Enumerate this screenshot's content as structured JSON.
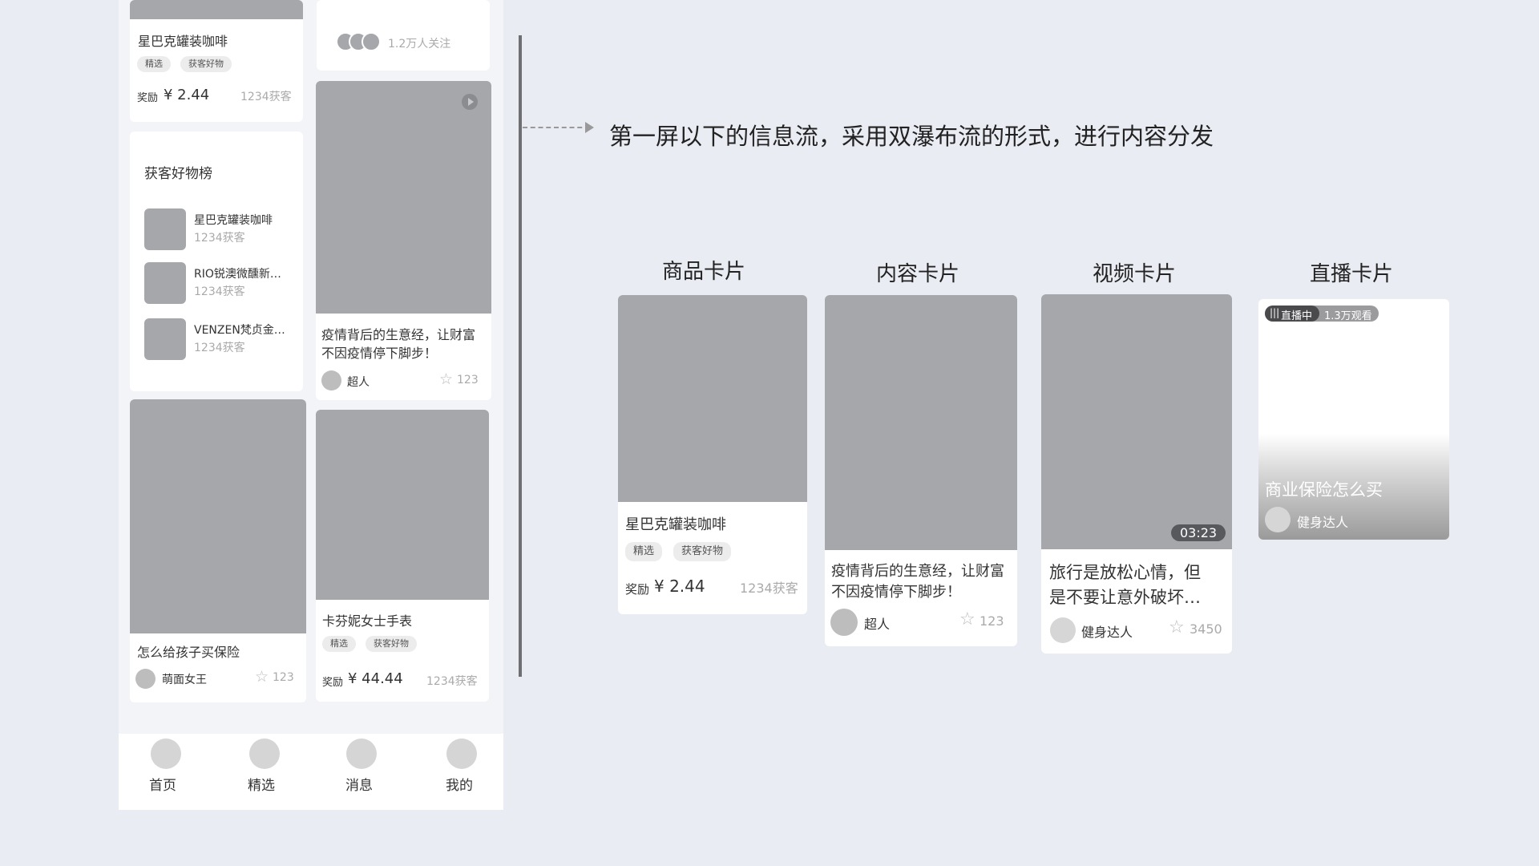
{
  "annotation": "第一屏以下的信息流，采用双瀑布流的形式，进行内容分发",
  "phone": {
    "col_left": {
      "card1": {
        "title": "星巴克罐装咖啡",
        "tags": [
          "精选",
          "获客好物"
        ],
        "reward_label": "奖励",
        "price": "¥ 2.44",
        "customers": "1234获客"
      },
      "ranking": {
        "title": "获客好物榜",
        "items": [
          {
            "name": "星巴克罐装咖啡",
            "sub": "1234获客"
          },
          {
            "name": "RIO锐澳微醺新…",
            "sub": "1234获客"
          },
          {
            "name": "VENZEN梵贞金…",
            "sub": "1234获客"
          }
        ]
      },
      "card3": {
        "title": "怎么给孩子买保险",
        "author": "萌面女王",
        "likes": "123"
      }
    },
    "col_right": {
      "follow": {
        "text": "1.2万人关注"
      },
      "content_card": {
        "title_line1": "疫情背后的生意经，让财富",
        "title_line2": "不因疫情停下脚步！",
        "author": "超人",
        "likes": "123"
      },
      "product_card": {
        "title": "卡芬妮女士手表",
        "tags": [
          "精选",
          "获客好物"
        ],
        "reward_label": "奖励",
        "price": "¥ 44.44",
        "customers": "1234获客"
      }
    },
    "tabbar": [
      {
        "label": "首页"
      },
      {
        "label": "精选"
      },
      {
        "label": "消息"
      },
      {
        "label": "我的"
      }
    ]
  },
  "showcase": {
    "product": {
      "heading": "商品卡片",
      "title": "星巴克罐装咖啡",
      "tags": [
        "精选",
        "获客好物"
      ],
      "reward_label": "奖励",
      "price": "¥ 2.44",
      "customers": "1234获客"
    },
    "content": {
      "heading": "内容卡片",
      "title_line1": "疫情背后的生意经，让财富",
      "title_line2": "不因疫情停下脚步！",
      "author": "超人",
      "likes": "123"
    },
    "video": {
      "heading": "视频卡片",
      "duration": "03:23",
      "title_line1": "旅行是放松心情，但",
      "title_line2": "是不要让意外破坏…",
      "author": "健身达人",
      "likes": "3450"
    },
    "live": {
      "heading": "直播卡片",
      "badge": "直播中",
      "viewers": "1.3万观看",
      "title": "商业保险怎么买",
      "author": "健身达人"
    }
  },
  "icons": {
    "star": "star-icon",
    "play": "play-icon",
    "live": "live-wave-icon"
  },
  "colors": {
    "background": "#e9ecf3",
    "placeholder": "#a6a7ab",
    "card": "#ffffff"
  }
}
